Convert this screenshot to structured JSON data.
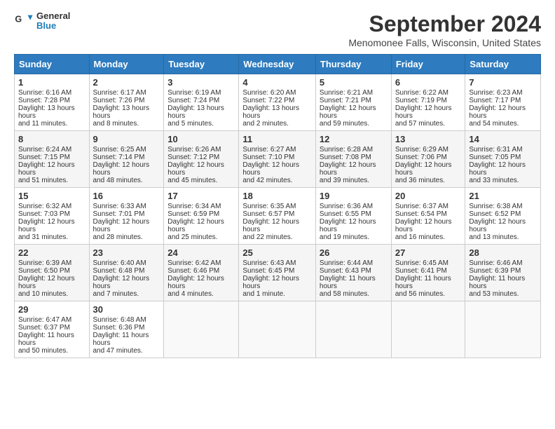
{
  "header": {
    "logo_line1": "General",
    "logo_line2": "Blue",
    "month_title": "September 2024",
    "location": "Menomonee Falls, Wisconsin, United States"
  },
  "days_of_week": [
    "Sunday",
    "Monday",
    "Tuesday",
    "Wednesday",
    "Thursday",
    "Friday",
    "Saturday"
  ],
  "weeks": [
    [
      {
        "day": "1",
        "info": "Sunrise: 6:16 AM\nSunset: 7:28 PM\nDaylight: 13 hours and 11 minutes."
      },
      {
        "day": "2",
        "info": "Sunrise: 6:17 AM\nSunset: 7:26 PM\nDaylight: 13 hours and 8 minutes."
      },
      {
        "day": "3",
        "info": "Sunrise: 6:19 AM\nSunset: 7:24 PM\nDaylight: 13 hours and 5 minutes."
      },
      {
        "day": "4",
        "info": "Sunrise: 6:20 AM\nSunset: 7:22 PM\nDaylight: 13 hours and 2 minutes."
      },
      {
        "day": "5",
        "info": "Sunrise: 6:21 AM\nSunset: 7:21 PM\nDaylight: 12 hours and 59 minutes."
      },
      {
        "day": "6",
        "info": "Sunrise: 6:22 AM\nSunset: 7:19 PM\nDaylight: 12 hours and 57 minutes."
      },
      {
        "day": "7",
        "info": "Sunrise: 6:23 AM\nSunset: 7:17 PM\nDaylight: 12 hours and 54 minutes."
      }
    ],
    [
      {
        "day": "8",
        "info": "Sunrise: 6:24 AM\nSunset: 7:15 PM\nDaylight: 12 hours and 51 minutes."
      },
      {
        "day": "9",
        "info": "Sunrise: 6:25 AM\nSunset: 7:14 PM\nDaylight: 12 hours and 48 minutes."
      },
      {
        "day": "10",
        "info": "Sunrise: 6:26 AM\nSunset: 7:12 PM\nDaylight: 12 hours and 45 minutes."
      },
      {
        "day": "11",
        "info": "Sunrise: 6:27 AM\nSunset: 7:10 PM\nDaylight: 12 hours and 42 minutes."
      },
      {
        "day": "12",
        "info": "Sunrise: 6:28 AM\nSunset: 7:08 PM\nDaylight: 12 hours and 39 minutes."
      },
      {
        "day": "13",
        "info": "Sunrise: 6:29 AM\nSunset: 7:06 PM\nDaylight: 12 hours and 36 minutes."
      },
      {
        "day": "14",
        "info": "Sunrise: 6:31 AM\nSunset: 7:05 PM\nDaylight: 12 hours and 33 minutes."
      }
    ],
    [
      {
        "day": "15",
        "info": "Sunrise: 6:32 AM\nSunset: 7:03 PM\nDaylight: 12 hours and 31 minutes."
      },
      {
        "day": "16",
        "info": "Sunrise: 6:33 AM\nSunset: 7:01 PM\nDaylight: 12 hours and 28 minutes."
      },
      {
        "day": "17",
        "info": "Sunrise: 6:34 AM\nSunset: 6:59 PM\nDaylight: 12 hours and 25 minutes."
      },
      {
        "day": "18",
        "info": "Sunrise: 6:35 AM\nSunset: 6:57 PM\nDaylight: 12 hours and 22 minutes."
      },
      {
        "day": "19",
        "info": "Sunrise: 6:36 AM\nSunset: 6:55 PM\nDaylight: 12 hours and 19 minutes."
      },
      {
        "day": "20",
        "info": "Sunrise: 6:37 AM\nSunset: 6:54 PM\nDaylight: 12 hours and 16 minutes."
      },
      {
        "day": "21",
        "info": "Sunrise: 6:38 AM\nSunset: 6:52 PM\nDaylight: 12 hours and 13 minutes."
      }
    ],
    [
      {
        "day": "22",
        "info": "Sunrise: 6:39 AM\nSunset: 6:50 PM\nDaylight: 12 hours and 10 minutes."
      },
      {
        "day": "23",
        "info": "Sunrise: 6:40 AM\nSunset: 6:48 PM\nDaylight: 12 hours and 7 minutes."
      },
      {
        "day": "24",
        "info": "Sunrise: 6:42 AM\nSunset: 6:46 PM\nDaylight: 12 hours and 4 minutes."
      },
      {
        "day": "25",
        "info": "Sunrise: 6:43 AM\nSunset: 6:45 PM\nDaylight: 12 hours and 1 minute."
      },
      {
        "day": "26",
        "info": "Sunrise: 6:44 AM\nSunset: 6:43 PM\nDaylight: 11 hours and 58 minutes."
      },
      {
        "day": "27",
        "info": "Sunrise: 6:45 AM\nSunset: 6:41 PM\nDaylight: 11 hours and 56 minutes."
      },
      {
        "day": "28",
        "info": "Sunrise: 6:46 AM\nSunset: 6:39 PM\nDaylight: 11 hours and 53 minutes."
      }
    ],
    [
      {
        "day": "29",
        "info": "Sunrise: 6:47 AM\nSunset: 6:37 PM\nDaylight: 11 hours and 50 minutes."
      },
      {
        "day": "30",
        "info": "Sunrise: 6:48 AM\nSunset: 6:36 PM\nDaylight: 11 hours and 47 minutes."
      },
      {
        "day": "",
        "info": ""
      },
      {
        "day": "",
        "info": ""
      },
      {
        "day": "",
        "info": ""
      },
      {
        "day": "",
        "info": ""
      },
      {
        "day": "",
        "info": ""
      }
    ]
  ]
}
